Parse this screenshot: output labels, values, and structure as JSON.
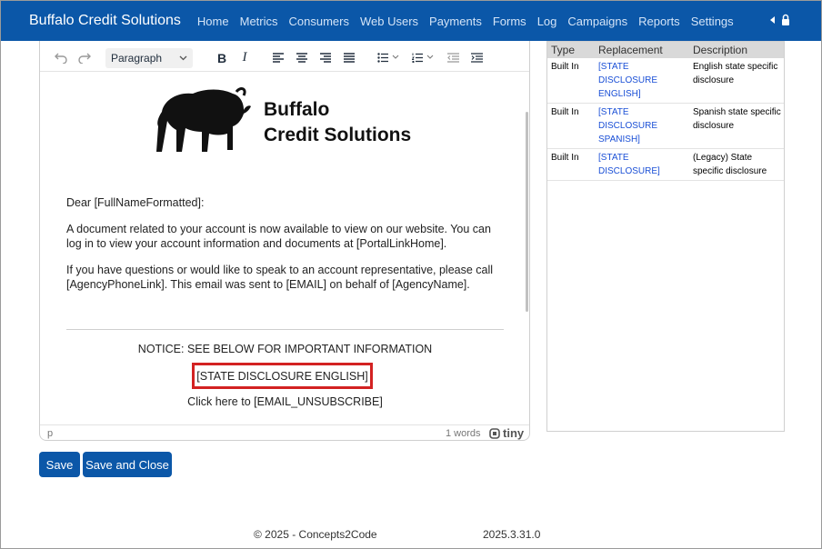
{
  "nav": {
    "brand": "Buffalo Credit Solutions",
    "links": [
      "Home",
      "Metrics",
      "Consumers",
      "Web Users",
      "Payments",
      "Forms",
      "Log",
      "Campaigns",
      "Reports",
      "Settings"
    ]
  },
  "toolbar": {
    "format_value": "Paragraph"
  },
  "document": {
    "logo_line1": "Buffalo",
    "logo_line2": "Credit Solutions",
    "greeting": "Dear [FullNameFormatted]:",
    "para1": "A document related to your account is now available to view on our website. You can log in to view your account information and documents at [PortalLinkHome].",
    "para2": "If you have questions or would like to speak to an account representative, please call [AgencyPhoneLink].  This email was sent to [EMAIL] on behalf of [AgencyName].",
    "notice": "NOTICE: SEE BELOW FOR IMPORTANT INFORMATION",
    "disclosure": "[STATE DISCLOSURE ENGLISH]",
    "unsubscribe": "Click here to [EMAIL_UNSUBSCRIBE]"
  },
  "status": {
    "path": "p",
    "words": "1 words",
    "brand": "tiny"
  },
  "buttons": {
    "save": "Save",
    "save_close": "Save and Close"
  },
  "table": {
    "headers": [
      "Type",
      "Replacement",
      "Description"
    ],
    "rows": [
      {
        "type": "Built In",
        "replacement": "[STATE DISCLOSURE ENGLISH]",
        "description": "English state specific disclosure"
      },
      {
        "type": "Built In",
        "replacement": "[STATE DISCLOSURE SPANISH]",
        "description": "Spanish state specific disclosure"
      },
      {
        "type": "Built In",
        "replacement": "[STATE DISCLOSURE]",
        "description": "(Legacy) State specific disclosure"
      }
    ]
  },
  "footer": {
    "copyright": "© 2025 - Concepts2Code",
    "version": "2025.3.31.0"
  },
  "colors": {
    "nav_bg": "#0b57a8",
    "highlight_border": "#d32222",
    "link": "#1a4fd6"
  }
}
